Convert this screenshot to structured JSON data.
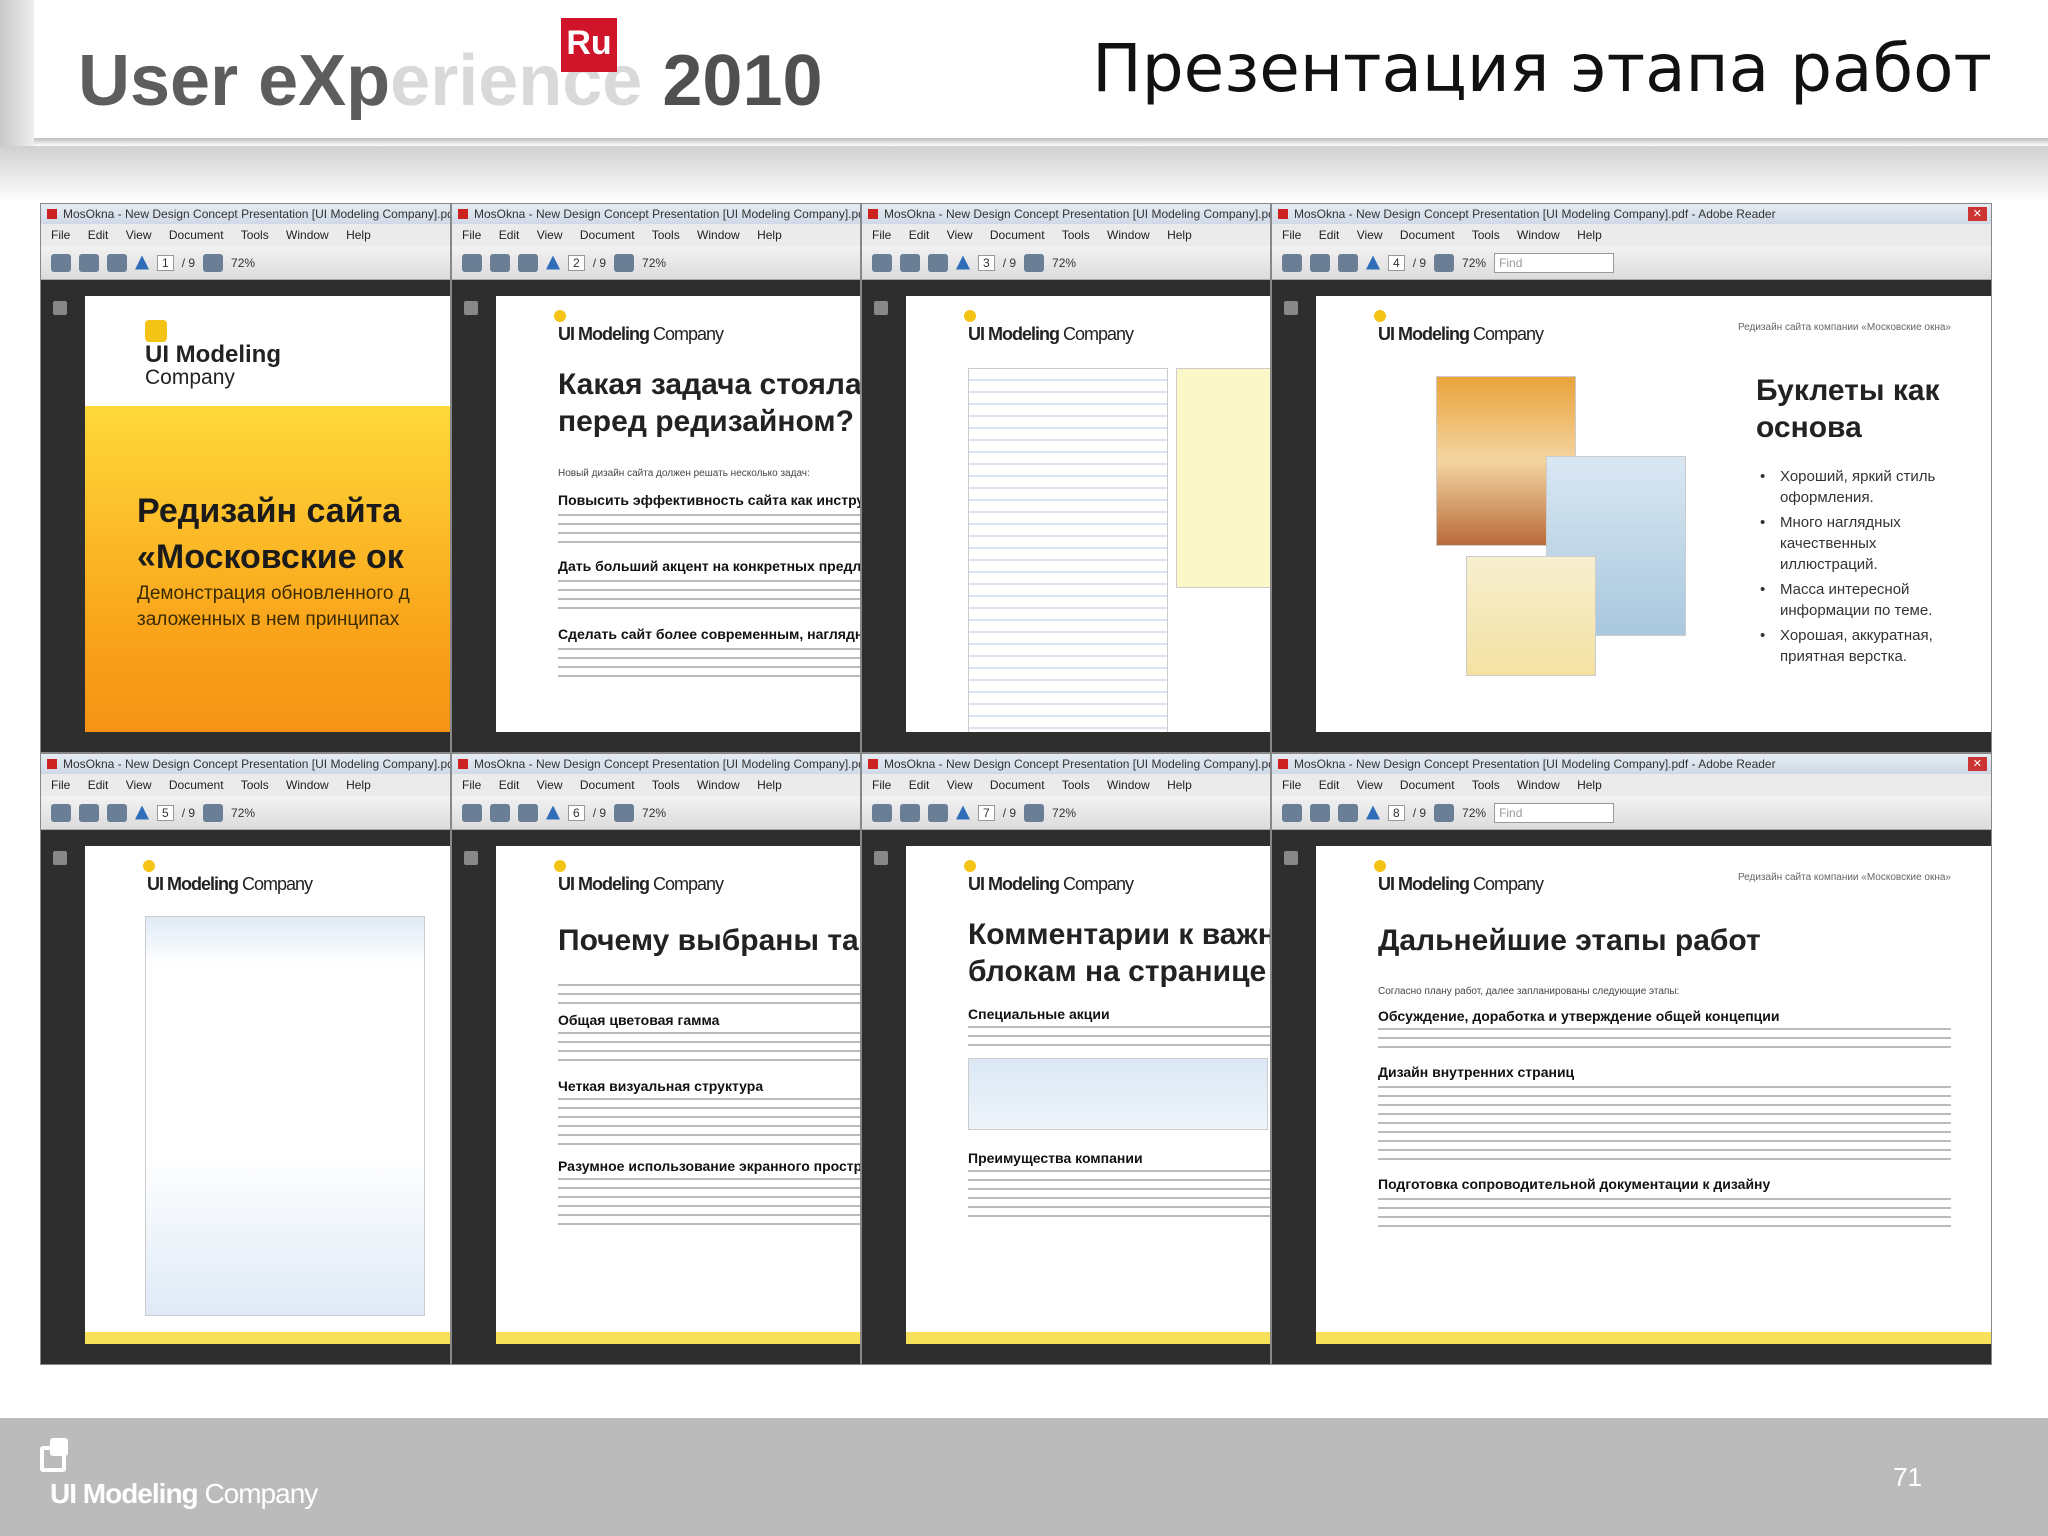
{
  "header": {
    "logo_main": "User eXp",
    "logo_fade": "erience",
    "logo_ru": "Ru",
    "logo_year": "2010",
    "title": "Презентация этапа работ"
  },
  "reader": {
    "titlebar": "MosOkna - New Design Concept Presentation [UI Modeling Company].pdf - Adobe Reader",
    "menu": [
      "File",
      "Edit",
      "View",
      "Document",
      "Tools",
      "Window",
      "Help"
    ],
    "page_total": "/ 9",
    "zoom": "72%",
    "find_placeholder": "Find"
  },
  "windows": [
    {
      "page": "1"
    },
    {
      "page": "2"
    },
    {
      "page": "3"
    },
    {
      "page": "4"
    },
    {
      "page": "5"
    },
    {
      "page": "6"
    },
    {
      "page": "7"
    },
    {
      "page": "8"
    }
  ],
  "brand": {
    "bold": "UI Modeling",
    "light": "Company"
  },
  "slide1": {
    "brand_bold": "UI Modeling",
    "brand_light": "Company",
    "title_l1": "Редизайн сайта",
    "title_l2": "«Московские ок",
    "sub_l1": "Демонстрация обновленного д",
    "sub_l2": "заложенных в нем принципах"
  },
  "slide2": {
    "title_l1": "Какая задача стояла",
    "title_l2": "перед редизайном?",
    "intro": "Новый дизайн сайта должен решать несколько задач:",
    "h1": "Повысить эффективность сайта как инструм",
    "h2": "Дать больший акцент на конкретных предло",
    "h3": "Сделать сайт более современным, наглядны"
  },
  "slide4": {
    "tag": "Редизайн сайта компании «Московские окна»",
    "title_l1": "Буклеты как",
    "title_l2": "основа",
    "bullets": [
      "Хороший, яркий стиль оформления.",
      "Много наглядных качественных иллюстраций.",
      "Масса интересной информации по теме.",
      "Хорошая, аккуратная, приятная верстка."
    ]
  },
  "slide6": {
    "title": "Почему выбраны так",
    "h1": "Общая цветовая гамма",
    "h2": "Четкая визуальная структура",
    "h3": "Разумное использование экранного простра"
  },
  "slide7": {
    "title_l1": "Комментарии к важны",
    "title_l2": "блокам на странице",
    "h1": "Специальные акции",
    "h2": "Преимущества компании"
  },
  "slide8": {
    "tag": "Редизайн сайта компании «Московские окна»",
    "title": "Дальнейшие этапы работ",
    "intro": "Согласно плану работ, далее запланированы следующие этапы:",
    "h1": "Обсуждение, доработка и утверждение общей концепции",
    "h2": "Дизайн внутренних страниц",
    "h3": "Подготовка сопроводительной документации к дизайну"
  },
  "footer": {
    "brand_bold": "UI Modeling",
    "brand_light": "Company",
    "page_number": "71"
  }
}
